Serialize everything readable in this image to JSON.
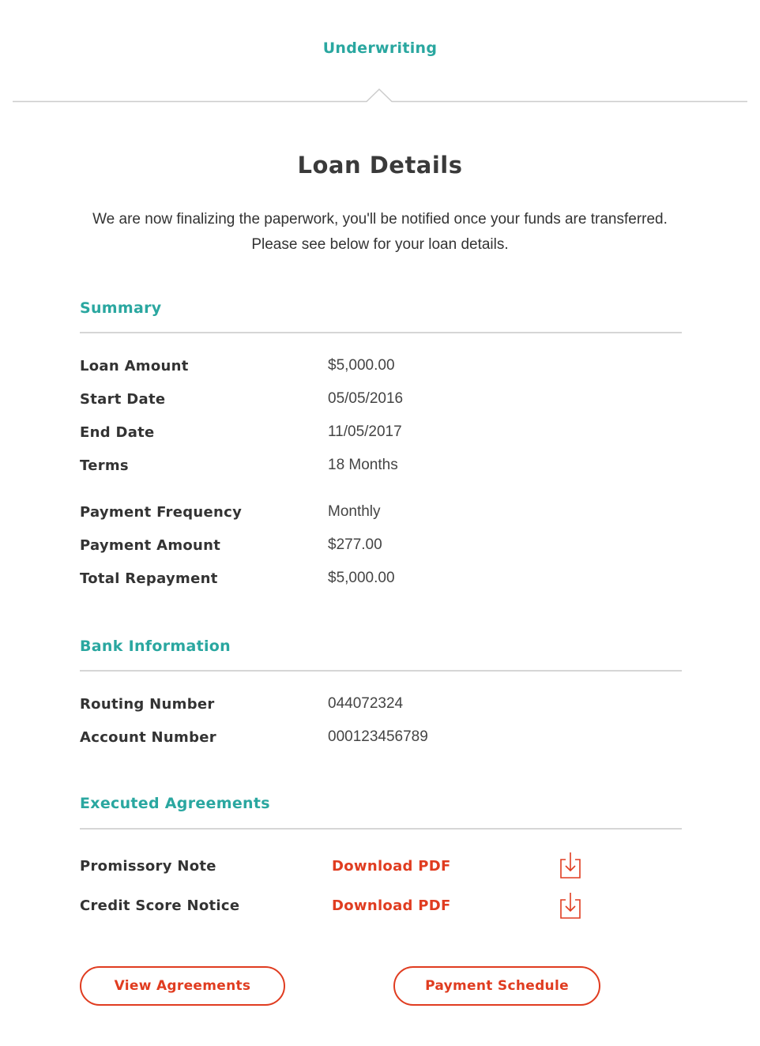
{
  "header": {
    "step_label": "Underwriting"
  },
  "page": {
    "title": "Loan Details",
    "intro_line1": "We are now finalizing the paperwork, you'll be notified once your funds are transferred.",
    "intro_line2": "Please see below for your loan details."
  },
  "summary": {
    "heading": "Summary",
    "rows": [
      {
        "label": "Loan Amount",
        "value": "$5,000.00"
      },
      {
        "label": "Start Date",
        "value": "05/05/2016"
      },
      {
        "label": "End Date",
        "value": "11/05/2017"
      },
      {
        "label": "Terms",
        "value": "18 Months"
      },
      {
        "label": "Payment Frequency",
        "value": "Monthly"
      },
      {
        "label": "Payment Amount",
        "value": "$277.00"
      },
      {
        "label": "Total Repayment",
        "value": "$5,000.00"
      }
    ]
  },
  "bank": {
    "heading": "Bank Information",
    "rows": [
      {
        "label": "Routing Number",
        "value": "044072324"
      },
      {
        "label": "Account Number",
        "value": "000123456789"
      }
    ]
  },
  "agreements": {
    "heading": "Executed Agreements",
    "rows": [
      {
        "label": "Promissory Note",
        "link": "Download PDF",
        "icon": "download-icon"
      },
      {
        "label": "Credit Score Notice",
        "link": "Download PDF",
        "icon": "download-icon"
      }
    ]
  },
  "actions": {
    "view_agreements": "View Agreements",
    "payment_schedule": "Payment Schedule"
  },
  "colors": {
    "accent_teal": "#2aa7a0",
    "action_red": "#e03c20",
    "rule_gray": "#d6d6d6"
  }
}
